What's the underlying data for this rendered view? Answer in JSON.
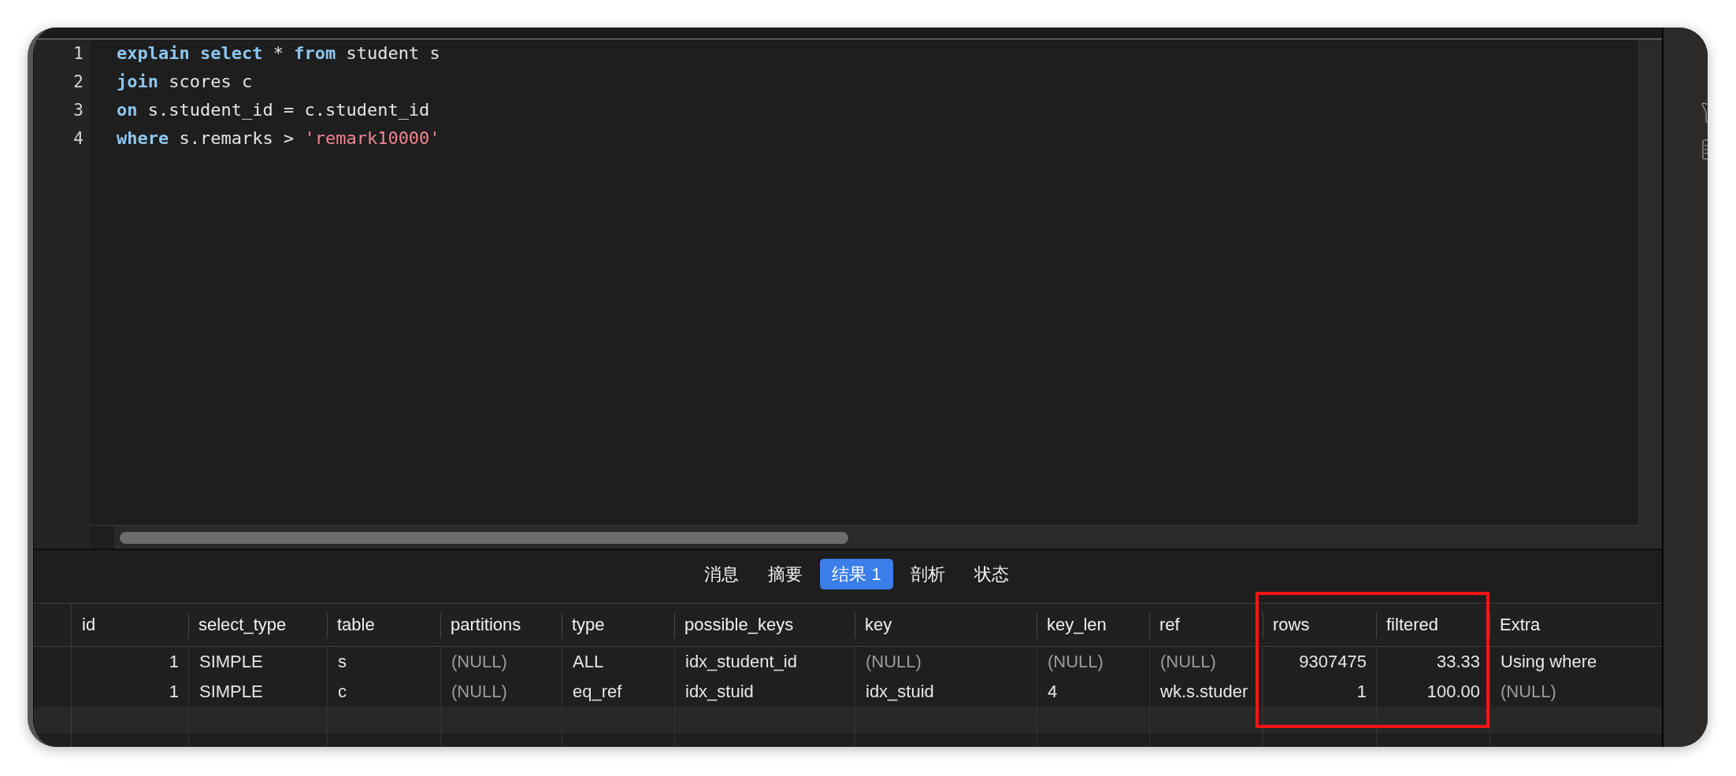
{
  "editor": {
    "lines": [
      {
        "number": "1",
        "tokens": [
          {
            "kind": "keyword",
            "text": "explain"
          },
          {
            "kind": "keyword",
            "text": " select"
          },
          {
            "kind": "plain",
            "text": " * "
          },
          {
            "kind": "keyword",
            "text": "from"
          },
          {
            "kind": "plain",
            "text": " student s"
          }
        ]
      },
      {
        "number": "2",
        "tokens": [
          {
            "kind": "keyword",
            "text": "join"
          },
          {
            "kind": "plain",
            "text": " scores c"
          }
        ]
      },
      {
        "number": "3",
        "tokens": [
          {
            "kind": "keyword",
            "text": "on"
          },
          {
            "kind": "plain",
            "text": " s.student_id = c.student_id"
          }
        ]
      },
      {
        "number": "4",
        "tokens": [
          {
            "kind": "keyword",
            "text": "where"
          },
          {
            "kind": "plain",
            "text": " s.remarks > "
          },
          {
            "kind": "string",
            "text": "'remark10000'"
          }
        ]
      }
    ]
  },
  "result_tabs": [
    {
      "label": "消息",
      "selected": false
    },
    {
      "label": "摘要",
      "selected": false
    },
    {
      "label": "结果 1",
      "selected": true
    },
    {
      "label": "剖析",
      "selected": false
    },
    {
      "label": "状态",
      "selected": false
    }
  ],
  "result_table": {
    "columns": [
      {
        "label": "id",
        "numeric": true
      },
      {
        "label": "select_type",
        "numeric": false
      },
      {
        "label": "table",
        "numeric": false
      },
      {
        "label": "partitions",
        "numeric": false
      },
      {
        "label": "type",
        "numeric": false
      },
      {
        "label": "possible_keys",
        "numeric": false
      },
      {
        "label": "key",
        "numeric": false
      },
      {
        "label": "key_len",
        "numeric": false
      },
      {
        "label": "ref",
        "numeric": false
      },
      {
        "label": "rows",
        "numeric": true
      },
      {
        "label": "filtered",
        "numeric": true
      },
      {
        "label": "Extra",
        "numeric": false
      }
    ],
    "rows": [
      {
        "cells": [
          {
            "text": "1",
            "null": false
          },
          {
            "text": "SIMPLE",
            "null": false
          },
          {
            "text": "s",
            "null": false
          },
          {
            "text": "(NULL)",
            "null": true
          },
          {
            "text": "ALL",
            "null": false
          },
          {
            "text": "idx_student_id",
            "null": false
          },
          {
            "text": "(NULL)",
            "null": true
          },
          {
            "text": "(NULL)",
            "null": true
          },
          {
            "text": "(NULL)",
            "null": true
          },
          {
            "text": "9307475",
            "null": false
          },
          {
            "text": "33.33",
            "null": false
          },
          {
            "text": "Using where",
            "null": false
          }
        ]
      },
      {
        "cells": [
          {
            "text": "1",
            "null": false
          },
          {
            "text": "SIMPLE",
            "null": false
          },
          {
            "text": "c",
            "null": false
          },
          {
            "text": "(NULL)",
            "null": true
          },
          {
            "text": "eq_ref",
            "null": false
          },
          {
            "text": "idx_stuid",
            "null": false
          },
          {
            "text": "idx_stuid",
            "null": false
          },
          {
            "text": "4",
            "null": false
          },
          {
            "text": "wk.s.studer",
            "null": false
          },
          {
            "text": "1",
            "null": false
          },
          {
            "text": "100.00",
            "null": false
          },
          {
            "text": "(NULL)",
            "null": true
          }
        ]
      }
    ],
    "annotation": {
      "kind": "rectangle"
    }
  }
}
